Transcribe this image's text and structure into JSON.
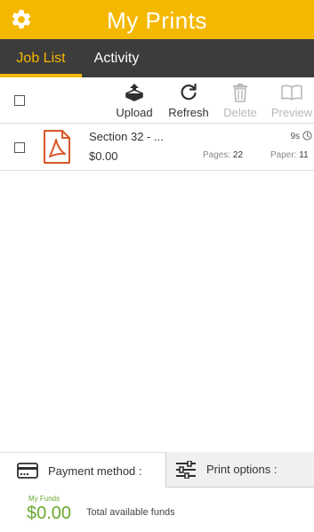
{
  "header": {
    "title": "My Prints",
    "settings_icon": "gear-icon"
  },
  "tabs": [
    {
      "label": "Job List",
      "active": true
    },
    {
      "label": "Activity",
      "active": false
    }
  ],
  "toolbar": {
    "upload_label": "Upload",
    "refresh_label": "Refresh",
    "delete_label": "Delete",
    "preview_label": "Preview"
  },
  "jobs": [
    {
      "name": "Section 32 - ...",
      "price": "$0.00",
      "age": "9s",
      "pages_label": "Pages:",
      "pages": "22",
      "paper_label": "Paper:",
      "paper": "11"
    }
  ],
  "bottom": {
    "payment_label": "Payment method :",
    "print_options_label": "Print options :",
    "funds_label": "My Funds",
    "funds_value": "$0.00",
    "funds_note": "Total available funds"
  },
  "colors": {
    "accent": "#f5b800",
    "tabbar": "#3c3c3c",
    "funds": "#6aa82e",
    "pdf": "#d9572b"
  }
}
